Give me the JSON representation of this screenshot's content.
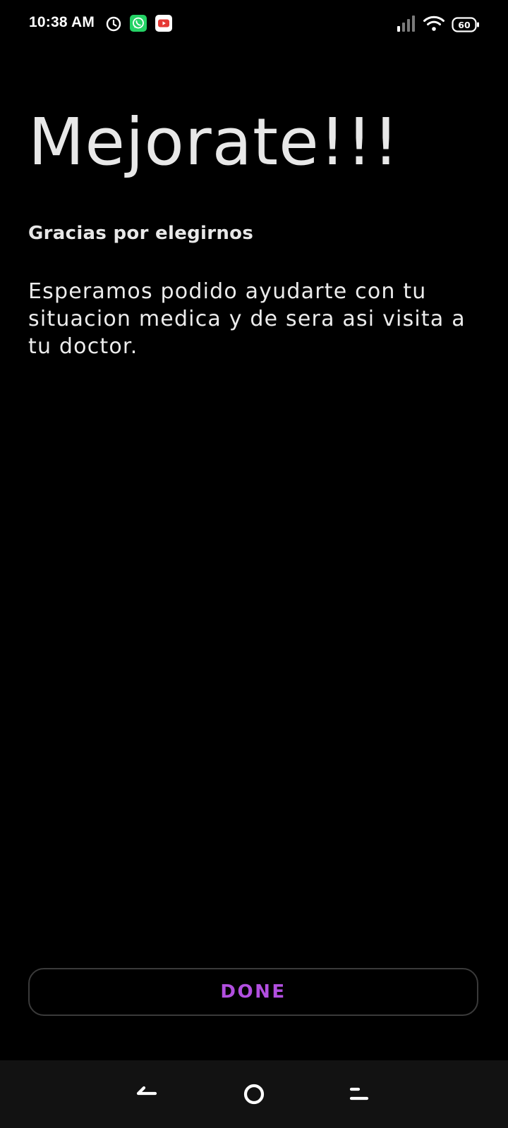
{
  "status_bar": {
    "time": "10:38 AM",
    "battery": "60",
    "icons": [
      "clock-icon",
      "whatsapp-icon",
      "youtube-icon",
      "signal-icon",
      "wifi-icon",
      "battery-icon"
    ]
  },
  "content": {
    "title": "Mejorate!!!",
    "subtitle": "Gracias por elegirnos",
    "body": "Esperamos podido ayudarte con tu situacion medica y de sera asi visita a tu doctor."
  },
  "actions": {
    "done_label": "DONE"
  },
  "nav_bar": {
    "buttons": [
      "back-icon",
      "home-icon",
      "recents-icon"
    ]
  },
  "colors": {
    "background": "#000000",
    "accent": "#B24FE0",
    "whatsapp": "#25D366",
    "youtube": "#E53935",
    "nav_background": "#121212"
  }
}
